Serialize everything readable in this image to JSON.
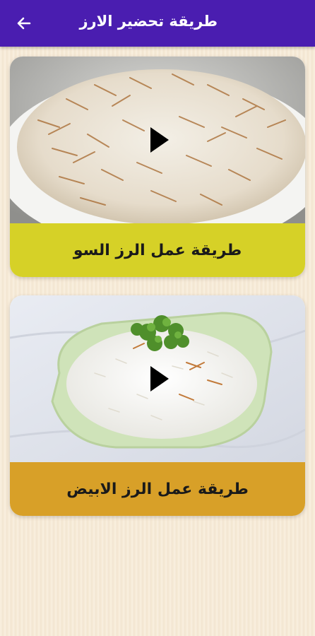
{
  "appbar": {
    "title": "طريقة تحضير الارز",
    "back_icon": "arrow-left-icon",
    "color": "#4a1db0"
  },
  "recipes": [
    {
      "label": "طريقة عمل الرز السو",
      "label_bg": "#d6d127",
      "image": "rice-with-vermicelli",
      "play_icon": "play-icon"
    },
    {
      "label": "طريقة عمل الرز الابيض",
      "label_bg": "#d8a028",
      "image": "white-rice-bowl",
      "play_icon": "play-icon"
    }
  ],
  "background": "#f7ead6"
}
